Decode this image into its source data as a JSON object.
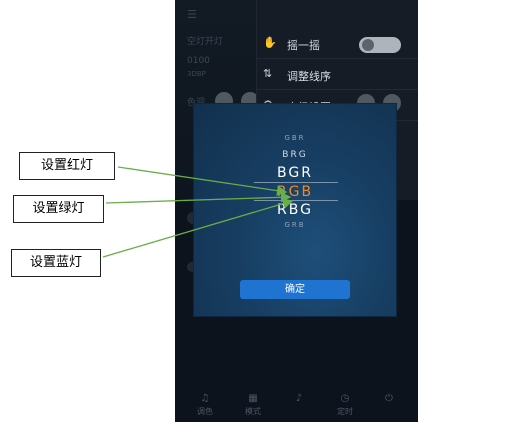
{
  "top_panel": {
    "header_glyph": "☰",
    "label_1": "空灯开灯",
    "value_1": "0100",
    "sub_1": "3DBP",
    "label_2": "色调"
  },
  "menu": {
    "items": [
      {
        "icon": "shake-icon",
        "label": "摇一摇",
        "control": "toggle",
        "state": "off"
      },
      {
        "icon": "reorder-icon",
        "label": "调整线序"
      },
      {
        "icon": "settings-icon",
        "label": "高级设置"
      }
    ]
  },
  "dialog": {
    "options": [
      "GBR",
      "BRG",
      "BGR",
      "RGB",
      "RBG",
      "GRB"
    ],
    "selected": "RGB",
    "confirm_label": "确定"
  },
  "annotations": {
    "red": "设置红灯",
    "green": "设置绿灯",
    "blue": "设置蓝灯"
  },
  "tabbar": {
    "items": [
      {
        "icon": "music-icon",
        "label": "调色"
      },
      {
        "icon": "grid-icon",
        "label": "模式"
      },
      {
        "icon": "mic-icon",
        "label": ""
      },
      {
        "icon": "timer-icon",
        "label": "定时"
      },
      {
        "icon": "power-icon",
        "label": ""
      }
    ]
  },
  "colors": {
    "accent": "#1e74d0",
    "selected_text": "#f08a24",
    "arrow": "#6aad4a"
  }
}
